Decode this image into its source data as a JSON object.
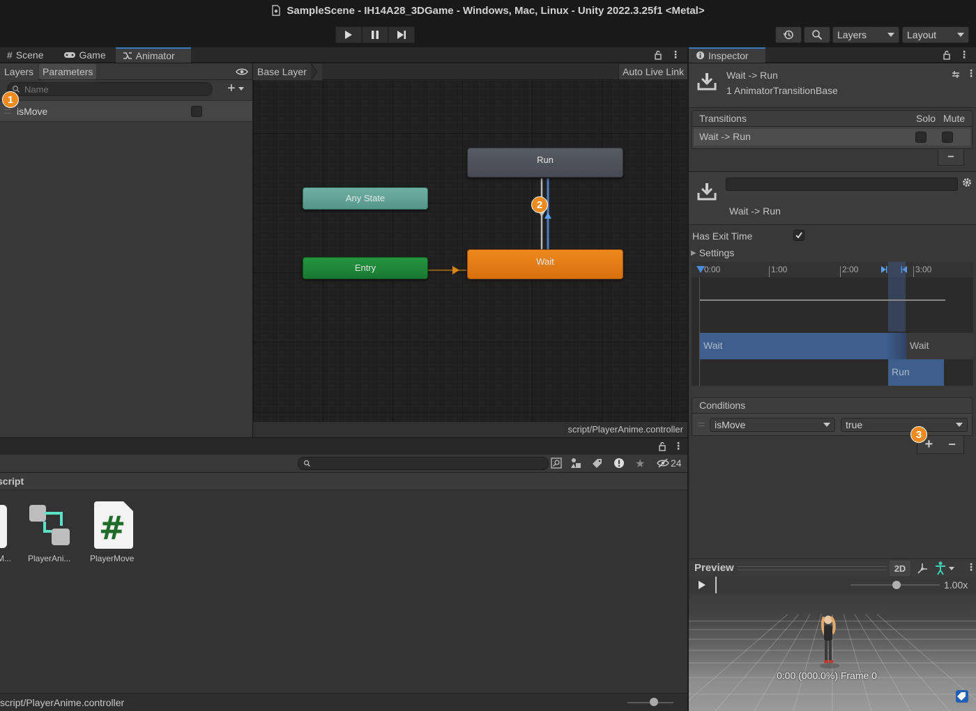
{
  "window": {
    "title": "SampleScene - IH14A28_3DGame - Windows, Mac, Linux - Unity 2022.3.25f1 <Metal>"
  },
  "toolbar": {
    "layers_label": "Layers",
    "layout_label": "Layout"
  },
  "left_tabs": {
    "scene": "Scene",
    "game": "Game",
    "animator": "Animator"
  },
  "animator": {
    "subtabs": {
      "layers": "Layers",
      "parameters": "Parameters"
    },
    "search_placeholder": "Name",
    "parameters": [
      {
        "name": "isMove",
        "value": false
      }
    ],
    "breadcrumb": "Base Layer",
    "auto_live_link": "Auto Live Link",
    "footer_path": "script/PlayerAnime.controller",
    "nodes": {
      "run": "Run",
      "any_state": "Any State",
      "entry": "Entry",
      "wait": "Wait"
    },
    "colors": {
      "run": "#4a4d55",
      "any_state": "#5fa59a",
      "entry": "#1e8a3a",
      "wait": "#e47d12"
    }
  },
  "project": {
    "filter_count": "24",
    "folder_label": "script",
    "assets": [
      {
        "name": "M..."
      },
      {
        "name": "PlayerAni..."
      },
      {
        "name": "PlayerMove"
      }
    ],
    "footer_path": "script/PlayerAnime.controller"
  },
  "inspector": {
    "tab": "Inspector",
    "header_title": "Wait -> Run",
    "header_subtitle": "1 AnimatorTransitionBase",
    "transitions_header": "Transitions",
    "solo": "Solo",
    "mute": "Mute",
    "transition_item": "Wait -> Run",
    "transition_name": "Wait -> Run",
    "has_exit_time": "Has Exit Time",
    "has_exit_time_checked": true,
    "settings": "Settings",
    "timeline": {
      "ticks": [
        "0:00",
        "1:00",
        "2:00",
        "3:00"
      ],
      "from_state": "Wait",
      "to_state": "Run",
      "next_from_state": "Wait"
    },
    "conditions_header": "Conditions",
    "condition": {
      "parameter": "isMove",
      "value": "true"
    }
  },
  "preview": {
    "label": "Preview",
    "mode_2d": "2D",
    "speed": "1.00x",
    "status": "0:00 (000.0%) Frame 0"
  },
  "annotations": [
    "1",
    "2",
    "3"
  ]
}
